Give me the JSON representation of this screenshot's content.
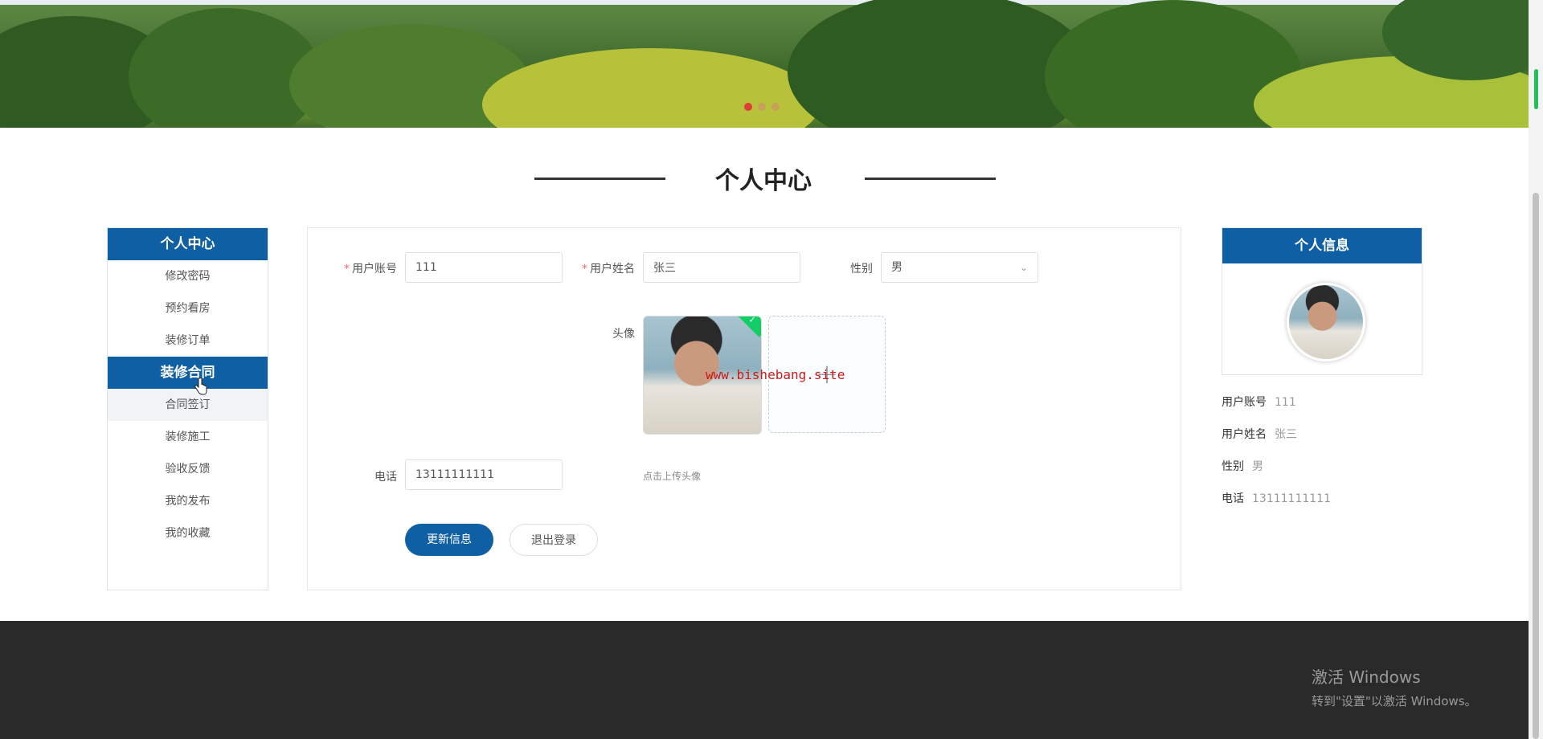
{
  "banner": {
    "active_dot_color": "#e03a3a"
  },
  "section": {
    "title": "个人中心"
  },
  "left_menu": {
    "header": "个人中心",
    "items": [
      "修改密码",
      "预约看房",
      "装修订单"
    ],
    "group": "装修合同",
    "sub_items": [
      "合同签订",
      "装修施工",
      "验收反馈",
      "我的发布",
      "我的收藏"
    ]
  },
  "form": {
    "account_label": "用户账号",
    "account_value": "111",
    "name_label": "用户姓名",
    "name_value": "张三",
    "gender_label": "性别",
    "gender_value": "男",
    "avatar_label": "头像",
    "upload_tip": "点击上传头像",
    "phone_label": "电话",
    "phone_value": "13111111111",
    "update_button": "更新信息",
    "logout_button": "退出登录"
  },
  "watermark": "www.bishebang.site",
  "info_card": {
    "header": "个人信息",
    "rows": [
      {
        "label": "用户账号",
        "value": "111"
      },
      {
        "label": "用户姓名",
        "value": "张三"
      },
      {
        "label": "性别",
        "value": "男"
      },
      {
        "label": "电话",
        "value": "13111111111"
      }
    ]
  },
  "windows_activation": {
    "line1": "激活 Windows",
    "line2": "转到\"设置\"以激活 Windows。"
  },
  "colors": {
    "primary": "#0e5fa3",
    "footer": "#2a2a2a",
    "required": "#f56c6c"
  }
}
